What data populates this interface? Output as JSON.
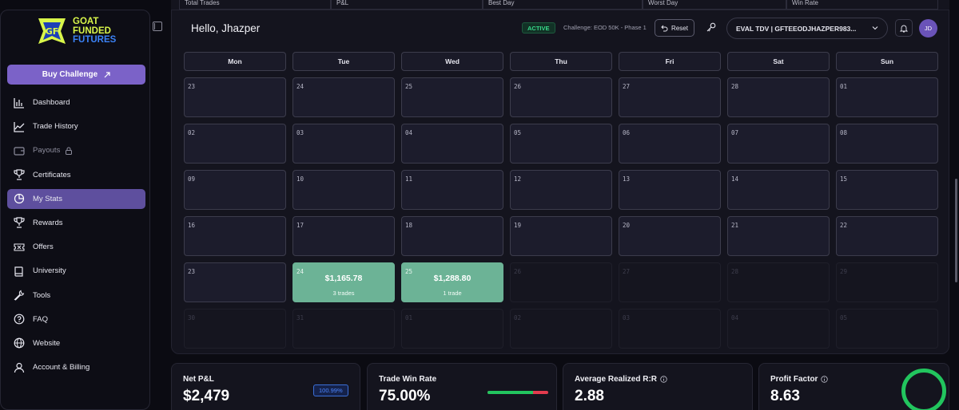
{
  "sidebar": {
    "logo_lines": [
      "GOAT",
      "FUNDED",
      "FUTURES"
    ],
    "buy_button": "Buy Challenge",
    "items": [
      {
        "label": "Dashboard",
        "icon": "bar-chart-icon"
      },
      {
        "label": "Trade History",
        "icon": "line-chart-icon"
      },
      {
        "label": "Payouts",
        "icon": "wallet-icon",
        "locked": true
      },
      {
        "label": "Certificates",
        "icon": "trophy-icon"
      },
      {
        "label": "My Stats",
        "icon": "pie-chart-icon",
        "active": true
      },
      {
        "label": "Rewards",
        "icon": "trophy-icon"
      },
      {
        "label": "Offers",
        "icon": "ticket-icon"
      },
      {
        "label": "University",
        "icon": "book-icon"
      },
      {
        "label": "Tools",
        "icon": "wrench-icon"
      },
      {
        "label": "FAQ",
        "icon": "help-icon"
      },
      {
        "label": "Website",
        "icon": "globe-icon"
      },
      {
        "label": "Account & Billing",
        "icon": "user-icon"
      }
    ]
  },
  "top_strip": [
    "Total Trades",
    "P&L",
    "Best Day",
    "Worst Day",
    "Win Rate"
  ],
  "header": {
    "greeting": "Hello, Jhazper",
    "status": "ACTIVE",
    "challenge": "Challenge: EOD 50K - Phase 1",
    "reset_label": "Reset",
    "account": "EVAL TDV | GFTEEODJHAZPER983...",
    "avatar_initials": "JD"
  },
  "calendar": {
    "days": [
      "Mon",
      "Tue",
      "Wed",
      "Thu",
      "Fri",
      "Sat",
      "Sun"
    ],
    "weeks": [
      [
        {
          "n": "23"
        },
        {
          "n": "24"
        },
        {
          "n": "25"
        },
        {
          "n": "26"
        },
        {
          "n": "27"
        },
        {
          "n": "28"
        },
        {
          "n": "01"
        }
      ],
      [
        {
          "n": "02"
        },
        {
          "n": "03"
        },
        {
          "n": "04"
        },
        {
          "n": "05"
        },
        {
          "n": "06"
        },
        {
          "n": "07"
        },
        {
          "n": "08"
        }
      ],
      [
        {
          "n": "09"
        },
        {
          "n": "10"
        },
        {
          "n": "11"
        },
        {
          "n": "12"
        },
        {
          "n": "13"
        },
        {
          "n": "14"
        },
        {
          "n": "15"
        }
      ],
      [
        {
          "n": "16"
        },
        {
          "n": "17"
        },
        {
          "n": "18"
        },
        {
          "n": "19"
        },
        {
          "n": "20"
        },
        {
          "n": "21"
        },
        {
          "n": "22"
        }
      ],
      [
        {
          "n": "23"
        },
        {
          "n": "24",
          "amount": "$1,165.78",
          "trades": "3 trades"
        },
        {
          "n": "25",
          "amount": "$1,288.80",
          "trades": "1 trade"
        },
        {
          "n": "26",
          "dim": true
        },
        {
          "n": "27",
          "dim": true
        },
        {
          "n": "28",
          "dim": true
        },
        {
          "n": "29",
          "dim": true
        }
      ],
      [
        {
          "n": "30",
          "dim": true
        },
        {
          "n": "31",
          "dim": true
        },
        {
          "n": "01",
          "dim": true
        },
        {
          "n": "02",
          "dim": true
        },
        {
          "n": "03",
          "dim": true
        },
        {
          "n": "04",
          "dim": true
        },
        {
          "n": "05",
          "dim": true
        }
      ]
    ]
  },
  "stats": {
    "net_pnl": {
      "label": "Net P&L",
      "value": "$2,479",
      "badge": "100.99%"
    },
    "win_rate": {
      "label": "Trade Win Rate",
      "value": "75.00%",
      "fraction": 0.75
    },
    "avg_rr": {
      "label": "Average Realized R:R",
      "value": "2.88"
    },
    "profit_factor": {
      "label": "Profit Factor",
      "value": "8.63"
    }
  },
  "colors": {
    "accent": "#7b62c8",
    "profit": "#6cb396",
    "active": "#38d98a",
    "win": "#22c55e",
    "loss": "#e33b4e"
  }
}
